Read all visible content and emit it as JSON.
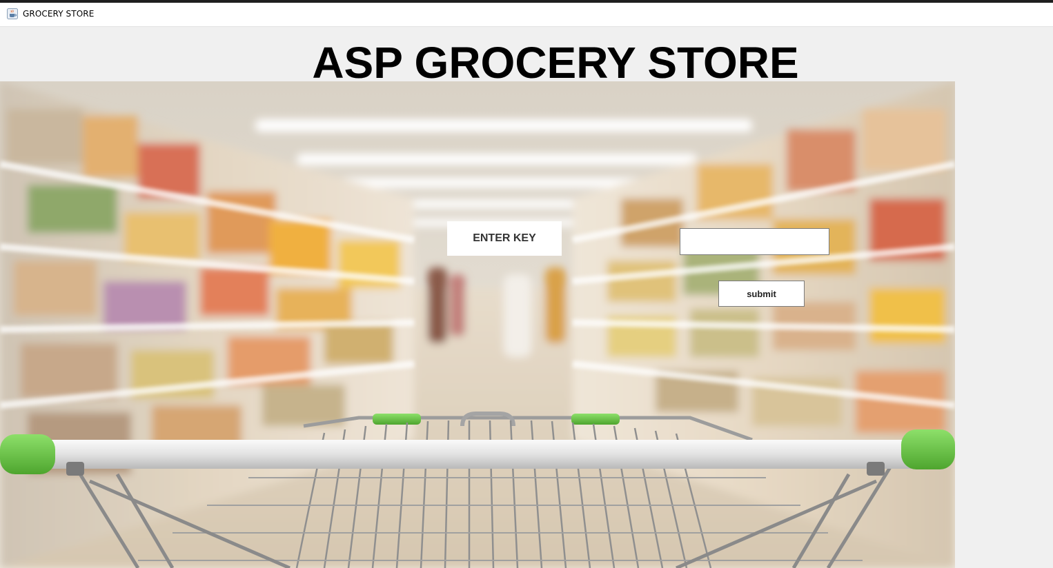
{
  "window": {
    "title": "GROCERY STORE",
    "app_icon": "java-cup-icon"
  },
  "main": {
    "heading": "ASP GROCERY STORE",
    "background_image": "supermarket-aisle-with-shopping-cart",
    "enter_key_label": "ENTER KEY",
    "key_input_value": "",
    "submit_label": "submit"
  },
  "colors": {
    "window_background": "#f0f0f0",
    "cart_handle_accent": "#6cc644"
  }
}
